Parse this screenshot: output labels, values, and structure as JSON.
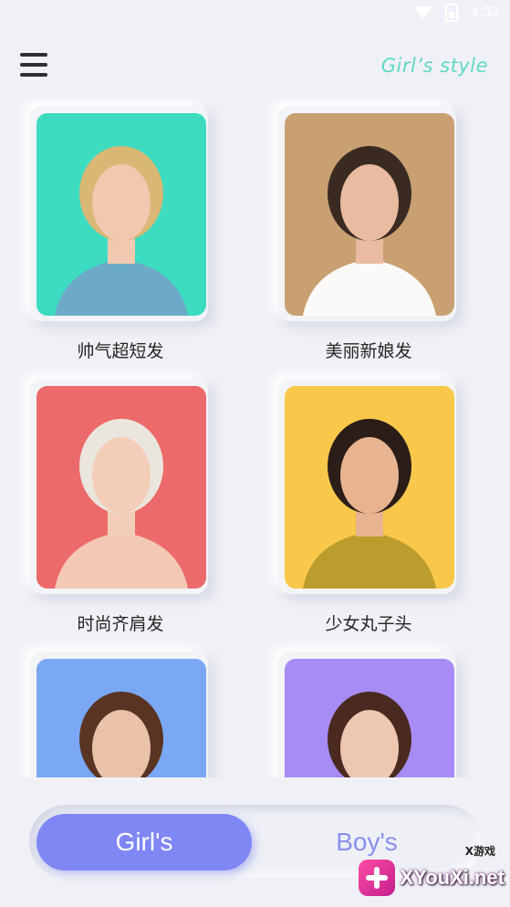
{
  "status_bar": {
    "time": "4:32"
  },
  "header": {
    "title": "Girl’s style"
  },
  "styles": [
    {
      "label": "帅气超短发",
      "photo": "short-hair-woman",
      "bg": "#3ddcc0",
      "hair": "#d9b774",
      "skin": "#f0c9b0",
      "cloth": "#6fa7c8"
    },
    {
      "label": "美丽新娘发",
      "photo": "bridal-hair-woman",
      "bg": "#c9a072",
      "hair": "#3a2a22",
      "skin": "#e9bba0",
      "cloth": "#ffffff"
    },
    {
      "label": "时尚齐肩发",
      "photo": "shoulder-length-hair-woman",
      "bg": "#ec6a6a",
      "hair": "#ebe6dd",
      "skin": "#f3cdb8",
      "cloth": "#f3cdb8"
    },
    {
      "label": "少女丸子头",
      "photo": "bun-hair-woman",
      "bg": "#f9c84a",
      "hair": "#2b1d18",
      "skin": "#e7b48f",
      "cloth": "#b79a2a"
    },
    {
      "label": "",
      "photo": "long-straight-hair-woman",
      "bg": "#7aa8f4",
      "hair": "#5a3423",
      "skin": "#eac2aa",
      "cloth": "#7aa8f4"
    },
    {
      "label": "",
      "photo": "wavy-hair-woman",
      "bg": "#a88cf5",
      "hair": "#4a2a20",
      "skin": "#eec7b0",
      "cloth": "#a88cf5"
    }
  ],
  "nav": {
    "girls_label": "Girl's",
    "boys_label": "Boy's"
  },
  "watermark": {
    "text": "XYouXi.net",
    "small": "X游戏"
  },
  "icons": {
    "menu": "hamburger-menu-icon",
    "wifi": "wifi-icon",
    "battery": "battery-icon"
  }
}
